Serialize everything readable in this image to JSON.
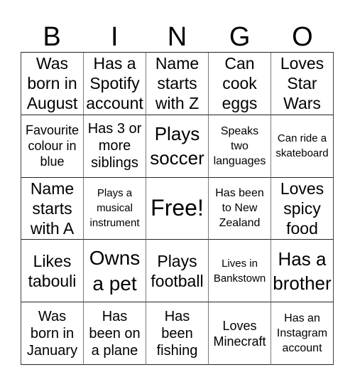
{
  "header": {
    "letters": [
      "B",
      "I",
      "N",
      "G",
      "O"
    ]
  },
  "grid": {
    "rows": [
      [
        "Was\nborn in\nAugust",
        "Has a\nSpotify\naccount",
        "Name\nstarts\nwith Z",
        "Can\ncook\neggs",
        "Loves\nStar\nWars"
      ],
      [
        "Favourite\ncolour in\nblue",
        "Has 3 or\nmore\nsiblings",
        "Plays\nsoccer",
        "Speaks\ntwo\nlanguages",
        "Can ride a\nskateboard"
      ],
      [
        "Name\nstarts\nwith A",
        "Plays a\nmusical\ninstrument",
        "Free!",
        "Has been\nto New\nZealand",
        "Loves\nspicy\nfood"
      ],
      [
        "Likes\ntabouli",
        "Owns\na pet",
        "Plays\nfootball",
        "Lives in\nBankstown",
        "Has a\nbrother"
      ],
      [
        "Was\nborn in\nJanuary",
        "Has\nbeen on\na plane",
        "Has\nbeen\nfishing",
        "Loves\nMinecraft",
        "Has an\nInstagram\naccount"
      ]
    ]
  }
}
